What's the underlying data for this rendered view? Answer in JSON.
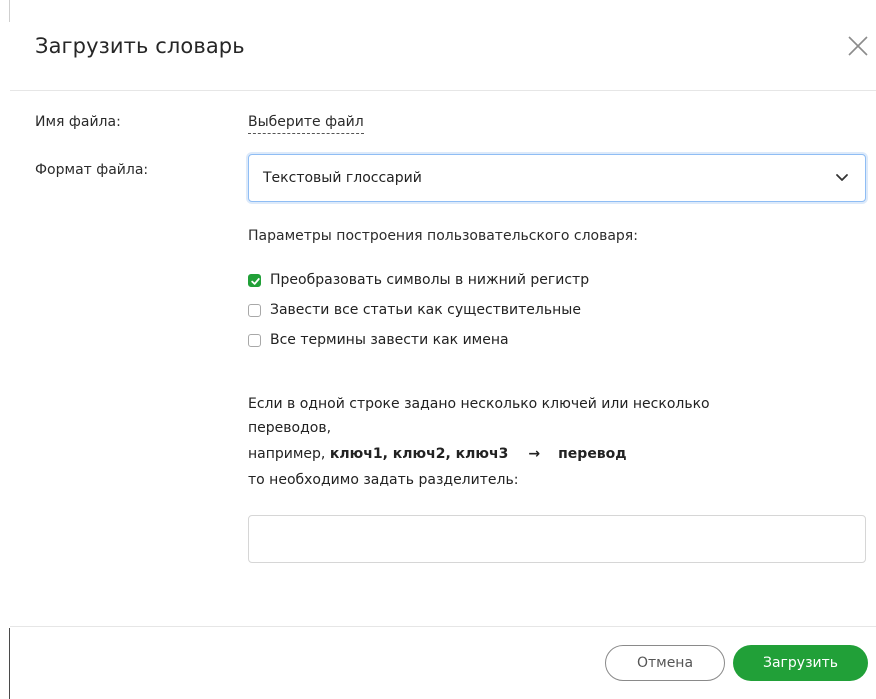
{
  "dialog": {
    "title": "Загрузить словарь",
    "close_icon": "close-icon"
  },
  "file": {
    "label": "Имя файла:",
    "choose_link": "Выберите файл"
  },
  "format": {
    "label": "Формат файла:",
    "selected": "Текстовый глоссарий",
    "chevron_icon": "chevron-down-icon"
  },
  "params": {
    "title": "Параметры построения пользовательского словаря:",
    "options": [
      {
        "label": "Преобразовать символы в нижний регистр",
        "checked": true
      },
      {
        "label": "Завести все статьи как существительные",
        "checked": false
      },
      {
        "label": "Все термины завести как имена",
        "checked": false
      }
    ]
  },
  "separator_help": {
    "line1": "Если в одной строке задано несколько ключей или несколько",
    "line2": "переводов,",
    "line3_prefix": "например, ",
    "example_keys": "ключ1, ключ2, ключ3",
    "arrow": "→",
    "example_translation": "перевод",
    "line4": "то необходимо задать разделитель:",
    "input_value": ""
  },
  "footer": {
    "cancel_label": "Отмена",
    "load_label": "Загрузить"
  },
  "colors": {
    "accent_green": "#21a038",
    "select_focus_border": "#8fbdf4"
  }
}
